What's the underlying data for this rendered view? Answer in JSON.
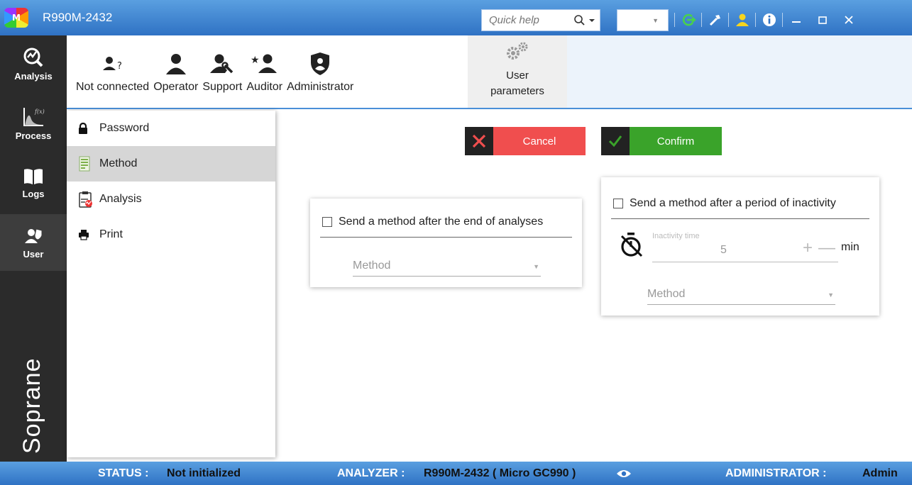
{
  "titlebar": {
    "logo_text": "M",
    "title": "R990M-2432",
    "quick_help_placeholder": "Quick help",
    "combo_value": "",
    "icons": [
      "refresh-icon",
      "tools-icon",
      "user-icon",
      "info-icon",
      "minimize-icon",
      "maximize-icon",
      "close-icon"
    ]
  },
  "rail": {
    "items": [
      {
        "label": "Analysis",
        "icon": "analysis-icon"
      },
      {
        "label": "Process",
        "icon": "process-icon"
      },
      {
        "label": "Logs",
        "icon": "logs-icon"
      },
      {
        "label": "User",
        "icon": "user-group-icon"
      }
    ],
    "brand": "Soprane"
  },
  "usertoolbar": {
    "profiles": [
      {
        "label": "Not connected",
        "icon": "user-unknown-icon"
      },
      {
        "label": "Operator",
        "icon": "user-icon"
      },
      {
        "label": "Support",
        "icon": "user-wrench-icon"
      },
      {
        "label": "Auditor",
        "icon": "user-star-icon"
      },
      {
        "label": "Administrator",
        "icon": "user-shield-icon"
      }
    ],
    "params_line1": "User",
    "params_line2": "parameters"
  },
  "sidebar": {
    "items": [
      {
        "label": "Password",
        "icon": "lock-icon"
      },
      {
        "label": "Method",
        "icon": "method-icon"
      },
      {
        "label": "Analysis",
        "icon": "clipboard-chart-icon"
      },
      {
        "label": "Print",
        "icon": "printer-icon"
      }
    ],
    "selected": "Method"
  },
  "actions": {
    "cancel": "Cancel",
    "confirm": "Confirm"
  },
  "card_end": {
    "checkbox_label": "Send a method after the end of analyses",
    "checked": false,
    "method_placeholder": "Method"
  },
  "card_inactivity": {
    "checkbox_label": "Send a method after a period of inactivity",
    "checked": false,
    "field_label": "Inactivity time",
    "field_value": "5",
    "unit": "min",
    "method_placeholder": "Method"
  },
  "statusbar": {
    "status_key": "STATUS :",
    "status_value": "Not initialized",
    "analyzer_key": "ANALYZER :",
    "analyzer_value": "R990M-2432 ( Micro GC990 )",
    "role_key": "ADMINISTRATOR :",
    "role_value": "Admin"
  },
  "colors": {
    "title_bar": "#3f86d4",
    "cancel": "#f04e4e",
    "confirm": "#3aa32a",
    "rail": "#2b2b2b",
    "refresh_icon": "#49d24a",
    "user_icon": "#f7d51d"
  }
}
